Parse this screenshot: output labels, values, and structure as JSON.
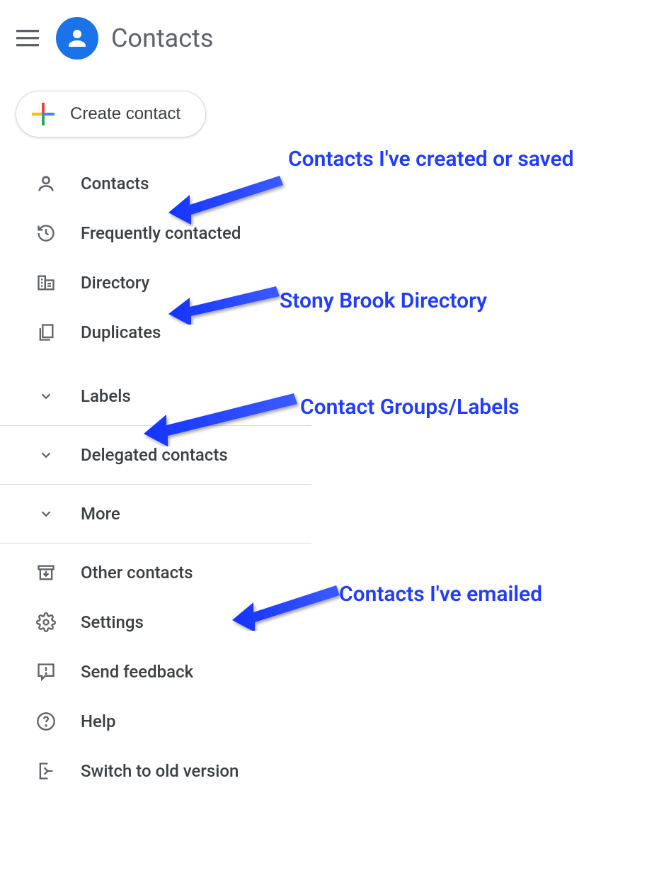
{
  "header": {
    "title": "Contacts"
  },
  "create_button": {
    "label": "Create contact"
  },
  "nav": {
    "contacts": "Contacts",
    "frequently": "Frequently contacted",
    "directory": "Directory",
    "duplicates": "Duplicates",
    "labels": "Labels",
    "delegated": "Delegated contacts",
    "more": "More",
    "other": "Other contacts",
    "settings": "Settings",
    "feedback": "Send feedback",
    "help": "Help",
    "switch": "Switch to old version"
  },
  "annotations": {
    "contacts": "Contacts I've created or saved",
    "directory": "Stony Brook Directory",
    "labels": "Contact Groups/Labels",
    "other": "Contacts I've emailed"
  }
}
